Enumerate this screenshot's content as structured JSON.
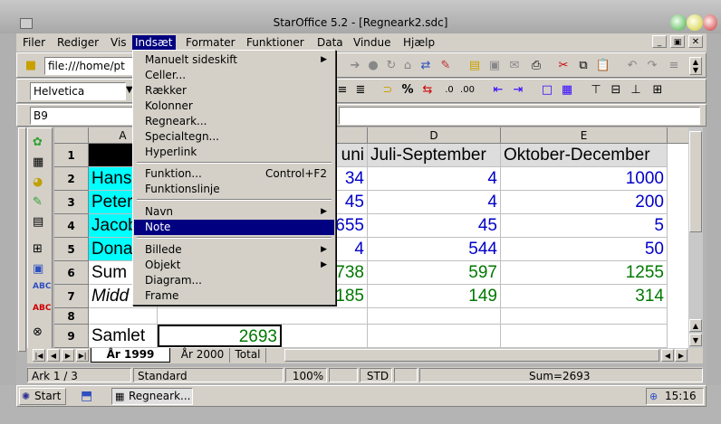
{
  "window": {
    "title": "StarOffice 5.2 - [Regneark2.sdc]"
  },
  "menubar": [
    "Filer",
    "Rediger",
    "Vis",
    "Indsæt",
    "Formater",
    "Funktioner",
    "Data",
    "Vindue",
    "Hjælp"
  ],
  "toolbar": {
    "url": "file:///home/pt",
    "font": "Helvetica"
  },
  "formula": {
    "cellref": "B9"
  },
  "columns": [
    "A",
    "",
    "D",
    "E"
  ],
  "rows": [
    "1",
    "2",
    "3",
    "4",
    "5",
    "6",
    "7",
    "8",
    "9"
  ],
  "cells": {
    "c1": "uni",
    "d1": "Juli-September",
    "e1": "Oktober-December",
    "a2": "Hans",
    "c2": "34",
    "d2": "4",
    "e2": "1000",
    "a3": "Peter",
    "c3": "45",
    "d3": "4",
    "e3": "200",
    "a4": "Jacob",
    "c4": "655",
    "d4": "45",
    "e4": "5",
    "a5": "Dona",
    "c5": "4",
    "d5": "544",
    "e5": "50",
    "a6": "Sum",
    "c6": "738",
    "d6": "597",
    "e6": "1255",
    "a7": "Midd",
    "c7": "185",
    "d7": "149",
    "e7": "314",
    "a9": "Samlet",
    "b9": "2693"
  },
  "tabs": [
    "År 1999",
    "År 2000",
    "Total"
  ],
  "status": {
    "sheet": "Ark 1 / 3",
    "style": "Standard",
    "zoom": "100%",
    "mode": "STD",
    "sum": "Sum=2693"
  },
  "taskbar": {
    "start": "Start",
    "task": "Regneark...",
    "clock": "15:16"
  },
  "dropdown": {
    "items": [
      {
        "label": "Manuelt sideskift",
        "sub": true
      },
      {
        "label": "Celler..."
      },
      {
        "label": "Rækker"
      },
      {
        "label": "Kolonner"
      },
      {
        "label": "Regneark..."
      },
      {
        "label": "Specialtegn..."
      },
      {
        "label": "Hyperlink"
      },
      {
        "label": "Funktion...",
        "shortcut": "Control+F2"
      },
      {
        "label": "Funktionslinje"
      },
      {
        "label": "Navn",
        "sub": true
      },
      {
        "label": "Note"
      },
      {
        "label": "Billede",
        "sub": true
      },
      {
        "label": "Objekt",
        "sub": true
      },
      {
        "label": "Diagram..."
      },
      {
        "label": "Frame"
      }
    ]
  },
  "colors": {
    "selection": "#000080",
    "cyan": "#00ffff",
    "blue": "#0000c8",
    "green": "#007800"
  }
}
